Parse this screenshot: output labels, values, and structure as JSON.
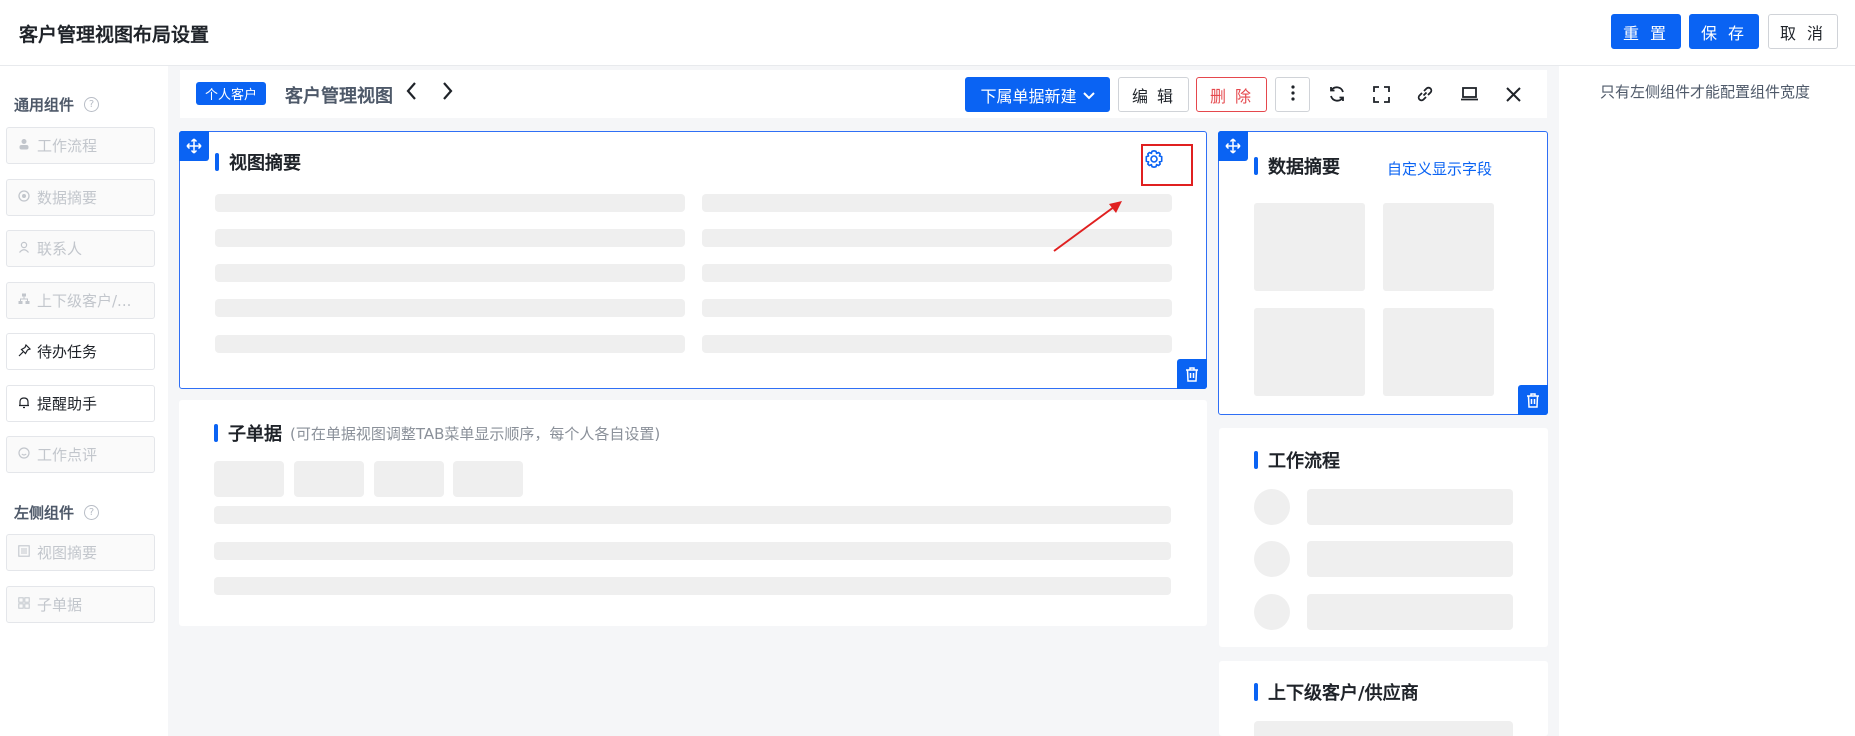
{
  "header": {
    "title": "客户管理视图布局设置",
    "reset_label": "重 置",
    "save_label": "保 存",
    "cancel_label": "取 消"
  },
  "palette": {
    "general_title": "通用组件",
    "general_items": [
      {
        "label": "工作流程",
        "icon": "person-icon",
        "enabled": false
      },
      {
        "label": "数据摘要",
        "icon": "circle-dot-icon",
        "enabled": false
      },
      {
        "label": "联系人",
        "icon": "user-icon",
        "enabled": false
      },
      {
        "label": "上下级客户/...",
        "icon": "org-tree-icon",
        "enabled": false
      },
      {
        "label": "待办任务",
        "icon": "pin-icon",
        "enabled": true
      },
      {
        "label": "提醒助手",
        "icon": "bell-icon",
        "enabled": true
      },
      {
        "label": "工作点评",
        "icon": "smile-icon",
        "enabled": false
      }
    ],
    "left_title": "左侧组件",
    "left_items": [
      {
        "label": "视图摘要",
        "icon": "list-icon",
        "enabled": false
      },
      {
        "label": "子单据",
        "icon": "grid-icon",
        "enabled": false
      }
    ]
  },
  "viewbar": {
    "tag": "个人客户",
    "title": "客户管理视图",
    "new_label": "下属单据新建",
    "edit_label": "编 辑",
    "delete_label": "删 除"
  },
  "cards": {
    "summary_title": "视图摘要",
    "subdoc_title": "子单据",
    "subdoc_note": "(可在单据视图调整TAB菜单显示顺序，每个人各自设置)",
    "data_summary_title": "数据摘要",
    "data_summary_link": "自定义显示字段",
    "workflow_title": "工作流程",
    "hierarchy_title": "上下级客户/供应商"
  },
  "hint": "只有左侧组件才能配置组件宽度",
  "colors": {
    "primary": "#0a63f3",
    "danger": "#e5484d",
    "annotation": "#e02020",
    "skeleton": "#efefef"
  }
}
